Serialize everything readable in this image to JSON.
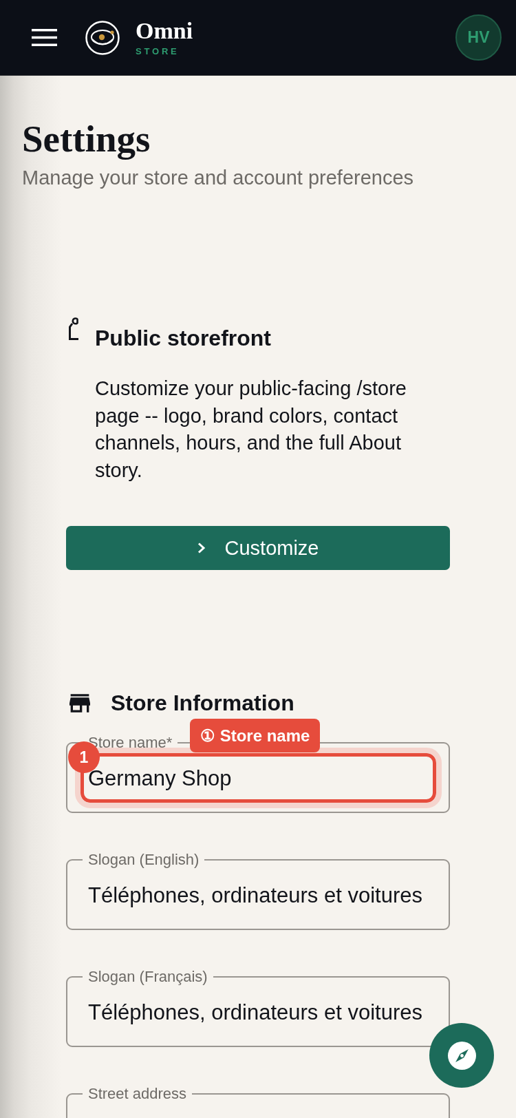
{
  "header": {
    "brand": {
      "name": "Omni",
      "tagline": "STORE"
    },
    "avatar": {
      "initials": "HV"
    }
  },
  "page": {
    "title": "Settings",
    "subtitle": "Manage your store and account preferences"
  },
  "storefront_card": {
    "title": "Public storefront",
    "description": "Customize your public-facing /store page -- logo, brand colors, contact channels, hours, and the full About story.",
    "button": {
      "label": "Customize"
    }
  },
  "store_information": {
    "title": "Store Information",
    "fields": [
      {
        "label": "Store name*",
        "value": "Germany Shop",
        "highlighted": true
      },
      {
        "label": "Slogan (English)",
        "value": "Téléphones, ordinateurs et voitures",
        "highlighted": false
      },
      {
        "label": "Slogan (Français)",
        "value": "Téléphones, ordinateurs et voitures",
        "highlighted": false
      },
      {
        "label": "Street address",
        "highlighted": false
      }
    ]
  },
  "tour": {
    "badge": "1",
    "tooltip": "① Store name"
  }
}
